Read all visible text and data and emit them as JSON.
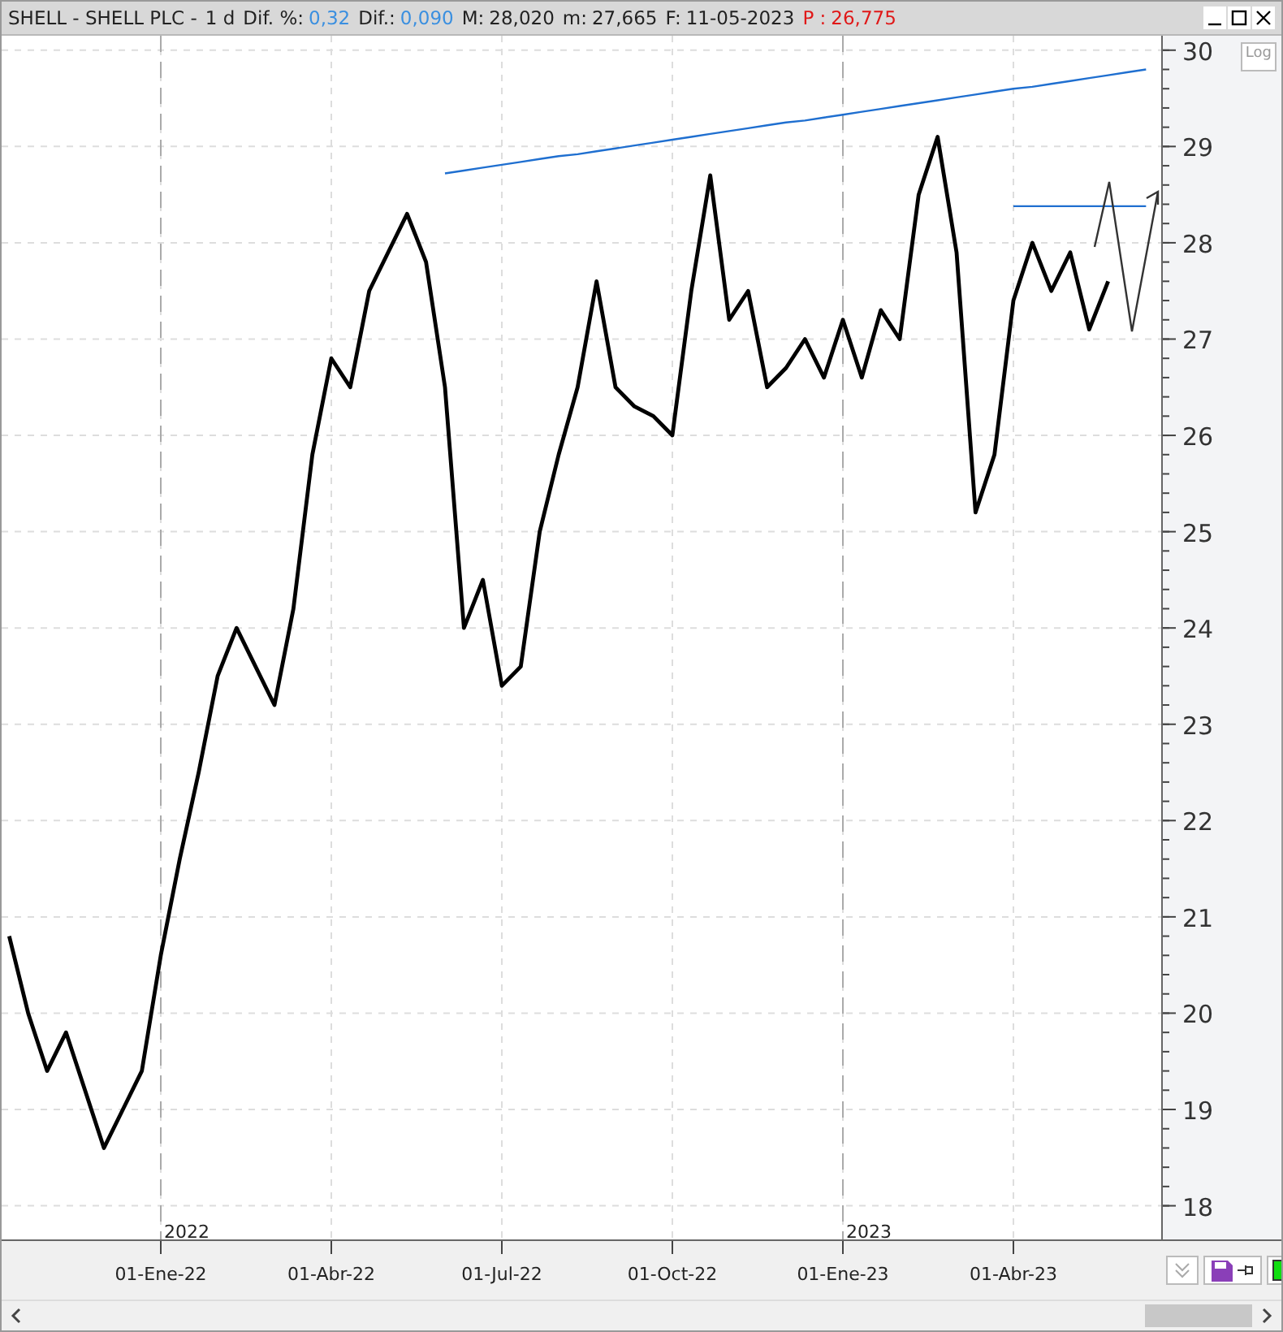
{
  "header": {
    "title": "SHELL - SHELL PLC -",
    "period": "1 d",
    "stats": [
      {
        "label": "Dif. %:",
        "value": "0,32",
        "kind": "change"
      },
      {
        "label": "Dif.:",
        "value": "0,090",
        "kind": "change"
      },
      {
        "label": "M:",
        "value": "28,020",
        "kind": "plain"
      },
      {
        "label": "m:",
        "value": "27,665",
        "kind": "plain"
      },
      {
        "label": "F:",
        "value": "11-05-2023",
        "kind": "plain"
      },
      {
        "label": "P :",
        "value": "26,775",
        "kind": "last"
      }
    ]
  },
  "scale_button": "Log",
  "year_labels": [
    "2022",
    "2023"
  ],
  "chart_data": {
    "type": "line",
    "grid": true,
    "ylim": [
      17.6,
      30.15
    ],
    "yticks": [
      18,
      19,
      20,
      21,
      22,
      23,
      24,
      25,
      26,
      27,
      28,
      29,
      30
    ],
    "categories": [
      null,
      null,
      null,
      null,
      null,
      null,
      null,
      null,
      "01-Ene-22",
      null,
      null,
      null,
      null,
      null,
      null,
      null,
      null,
      "01-Abr-22",
      null,
      null,
      null,
      null,
      null,
      null,
      null,
      null,
      "01-Jul-22",
      null,
      null,
      null,
      null,
      null,
      null,
      null,
      null,
      "01-Oct-22",
      null,
      null,
      null,
      null,
      null,
      null,
      null,
      null,
      "01-Ene-23",
      null,
      null,
      null,
      null,
      null,
      null,
      null,
      null,
      "01-Abr-23",
      null,
      null,
      null,
      null,
      null,
      null,
      null
    ],
    "series": [
      {
        "color": "#000000",
        "values": [
          20.8,
          20.0,
          19.4,
          19.8,
          19.2,
          18.6,
          19.0,
          19.4,
          20.6,
          21.6,
          22.5,
          23.5,
          24.0,
          23.6,
          23.2,
          24.2,
          25.8,
          26.8,
          26.5,
          27.5,
          27.9,
          28.3,
          27.8,
          26.5,
          24.0,
          24.5,
          23.4,
          23.6,
          25.0,
          25.8,
          26.5,
          27.6,
          26.5,
          26.3,
          26.2,
          26.0,
          27.5,
          28.7,
          27.2,
          27.5,
          26.5,
          26.7,
          27.0,
          26.6,
          27.2,
          26.6,
          27.3,
          27.0,
          28.5,
          29.1,
          27.9,
          25.2,
          25.8,
          27.4,
          28.0,
          27.5,
          27.9,
          27.1,
          27.6,
          null,
          null
        ]
      },
      {
        "color": "#1f6fd0",
        "values": [
          null,
          null,
          null,
          null,
          null,
          null,
          null,
          null,
          null,
          null,
          null,
          null,
          null,
          null,
          null,
          null,
          null,
          null,
          null,
          null,
          null,
          null,
          null,
          28.72,
          28.75,
          28.78,
          28.81,
          28.84,
          28.87,
          28.9,
          28.92,
          28.95,
          28.98,
          29.01,
          29.04,
          29.07,
          29.1,
          29.13,
          29.16,
          29.19,
          29.22,
          29.25,
          29.27,
          29.3,
          29.33,
          29.36,
          29.39,
          29.42,
          29.45,
          29.48,
          29.51,
          29.54,
          29.57,
          29.6,
          29.62,
          29.65,
          29.68,
          29.71,
          29.74,
          29.77,
          29.8
        ]
      },
      {
        "color": "#1f6fd0",
        "values": [
          null,
          null,
          null,
          null,
          null,
          null,
          null,
          null,
          null,
          null,
          null,
          null,
          null,
          null,
          null,
          null,
          null,
          null,
          null,
          null,
          null,
          null,
          null,
          null,
          null,
          null,
          null,
          null,
          null,
          null,
          null,
          null,
          null,
          null,
          null,
          null,
          null,
          null,
          null,
          null,
          null,
          null,
          null,
          null,
          null,
          null,
          null,
          null,
          null,
          null,
          null,
          null,
          null,
          28.38,
          28.38,
          28.38,
          28.38,
          28.38,
          28.38,
          28.38,
          28.38
        ]
      }
    ]
  }
}
